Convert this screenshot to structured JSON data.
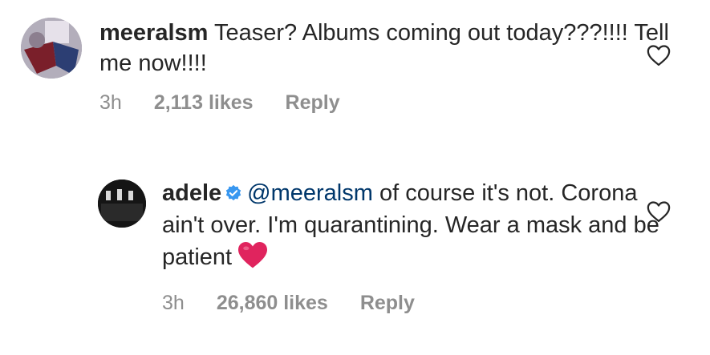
{
  "comments": [
    {
      "username": "meeralsm",
      "text": "Teaser? Albums coming out today???!!!! Tell me now!!!!",
      "time": "3h",
      "likes": "2,113 likes",
      "reply": "Reply"
    },
    {
      "username": "adele",
      "verified": true,
      "mention": "@meeralsm",
      "text": " of course it's not. Corona ain't over. I'm quarantining. Wear a mask and be patient",
      "emoji": "red-heart",
      "time": "3h",
      "likes": "26,860 likes",
      "reply": "Reply"
    }
  ],
  "colors": {
    "text": "#262626",
    "meta": "#8e8e8e",
    "mention": "#00376b",
    "verified": "#3897f0",
    "heart_emoji": "#e0245e"
  }
}
